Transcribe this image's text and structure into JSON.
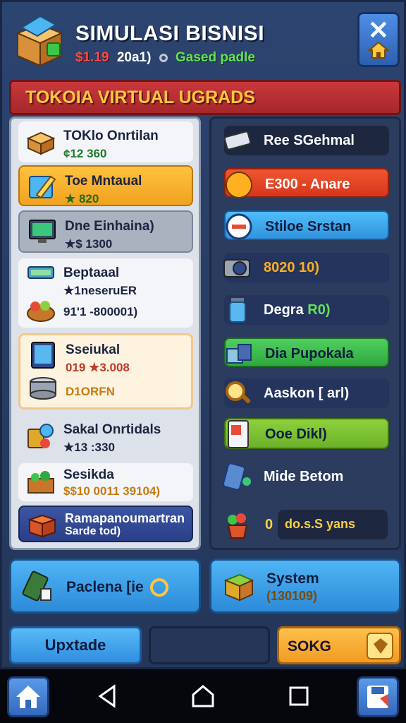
{
  "header": {
    "title": "SIMULASI BISNISI",
    "money": "$1.19",
    "time": "20a1)",
    "status": "Gased padle"
  },
  "banner": {
    "text": "TOKOIA VIRTUAL UGRADS"
  },
  "left_list": [
    {
      "title": "TOKlo Onrtilan",
      "value": "¢12 360"
    },
    {
      "title": "Toe Mntaual",
      "value": "★ 820"
    },
    {
      "title": "Dne Einhaina)",
      "value": "★$ 1300"
    },
    {
      "title": "Beptaaal",
      "value": "★1neseruER",
      "value2": "91'1 -800001)"
    },
    {
      "title": "Sseiukal",
      "value": "019  ★3.008",
      "value2": "D1ORFN"
    },
    {
      "title": "Sakal Onrtidals",
      "value": "★13 :330"
    },
    {
      "title": "Sesikda",
      "value": "$$10 0011 39104)"
    },
    {
      "title": "Ramapanoumartran",
      "value": "Sarde tod)"
    }
  ],
  "right_list": [
    {
      "label": "Ree SGehmal"
    },
    {
      "label": "E300 - Anare"
    },
    {
      "label": "Stiloe Srstan"
    },
    {
      "label": "8020 10)"
    },
    {
      "label": "Degra",
      "label_accent": "R0)"
    },
    {
      "label": "Dia Pupokala"
    },
    {
      "label": "Aaskon [ arl)"
    },
    {
      "label": "Ooe Dikl)"
    },
    {
      "label": "Mide Betom"
    },
    {
      "label": "0",
      "label_accent": "do.s.S yans"
    }
  ],
  "cards": {
    "left_label": "Paclena [ie",
    "right_title": "System",
    "right_value": "(130109)"
  },
  "actions": {
    "update_label": "Upxtade",
    "soko_label": "SOKG"
  },
  "colors": {
    "background": "#2a3f63",
    "banner": "#c9383b",
    "banner_text": "#ffc83d",
    "status_green": "#63e25a",
    "money_red": "#ff4b4b"
  },
  "icons": [
    "shop-box-icon",
    "home-icon",
    "close-icon",
    "back-icon",
    "circle-home-icon",
    "recents-icon"
  ]
}
